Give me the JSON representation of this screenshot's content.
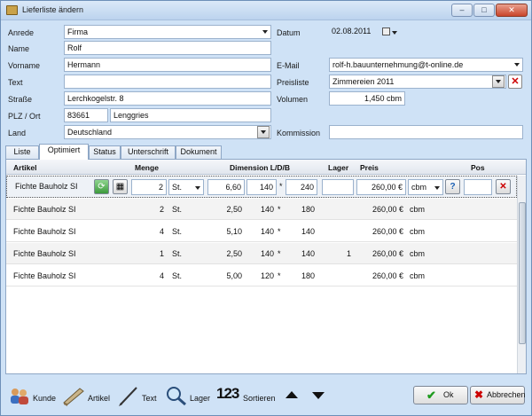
{
  "window": {
    "title": "Lieferliste ändern",
    "min": "–",
    "max": "□",
    "close": "✕"
  },
  "form": {
    "anrede_label": "Anrede",
    "anrede_value": "Firma",
    "name_label": "Name",
    "name_value": "Rolf",
    "vorname_label": "Vorname",
    "vorname_value": "Hermann",
    "text_label": "Text",
    "text_value": "",
    "strasse_label": "Straße",
    "strasse_value": "Lerchkogelstr. 8",
    "plz_label": "PLZ / Ort",
    "plz_value": "83661",
    "ort_value": "Lenggries",
    "land_label": "Land",
    "land_value": "Deutschland",
    "datum_label": "Datum",
    "datum_value": "02.08.2011",
    "email_label": "E-Mail",
    "email_value": "rolf-h.bauunternehmung@t-online.de",
    "preisliste_label": "Preisliste",
    "preisliste_value": "Zimmereien 2011",
    "volumen_label": "Volumen",
    "volumen_value": "1,450 cbm",
    "kommission_label": "Kommission",
    "kommission_value": ""
  },
  "tabs": [
    "Liste",
    "Optimiert",
    "Status",
    "Unterschrift",
    "Dokument"
  ],
  "grid": {
    "headers": {
      "artikel": "Artikel",
      "menge": "Menge",
      "dimension": "Dimension L/D/B",
      "lager": "Lager",
      "preis": "Preis",
      "pos": "Pos"
    },
    "edit_row": {
      "artikel": "Fichte Bauholz SI",
      "menge": "2",
      "unit": "St.",
      "l": "6,60",
      "d": "140",
      "x": "*",
      "b": "240",
      "lager": "",
      "preis": "260,00 €",
      "preis_unit": "cbm",
      "help": "?",
      "pos": "",
      "delete": "✕"
    },
    "rows": [
      {
        "artikel": "Fichte Bauholz SI",
        "menge": "2",
        "unit": "St.",
        "l": "2,50",
        "d": "140",
        "x": "*",
        "b": "180",
        "lager": "",
        "preis": "260,00 €",
        "preis_unit": "cbm"
      },
      {
        "artikel": "Fichte Bauholz SI",
        "menge": "4",
        "unit": "St.",
        "l": "5,10",
        "d": "140",
        "x": "*",
        "b": "140",
        "lager": "",
        "preis": "260,00 €",
        "preis_unit": "cbm"
      },
      {
        "artikel": "Fichte Bauholz SI",
        "menge": "1",
        "unit": "St.",
        "l": "2,50",
        "d": "140",
        "x": "*",
        "b": "140",
        "lager": "1",
        "preis": "260,00 €",
        "preis_unit": "cbm"
      },
      {
        "artikel": "Fichte Bauholz SI",
        "menge": "4",
        "unit": "St.",
        "l": "5,00",
        "d": "120",
        "x": "*",
        "b": "180",
        "lager": "",
        "preis": "260,00 €",
        "preis_unit": "cbm"
      }
    ]
  },
  "toolbar": {
    "kunde": "Kunde",
    "artikel": "Artikel",
    "text": "Text",
    "lager": "Lager",
    "sortieren": "Sortieren",
    "sort_icon": "123",
    "ok": "Ok",
    "abbrechen": "Abbrechen"
  },
  "colors": {
    "accent": "#cfe2f6",
    "delete": "#cc0000",
    "ok": "#1f9b1f"
  }
}
